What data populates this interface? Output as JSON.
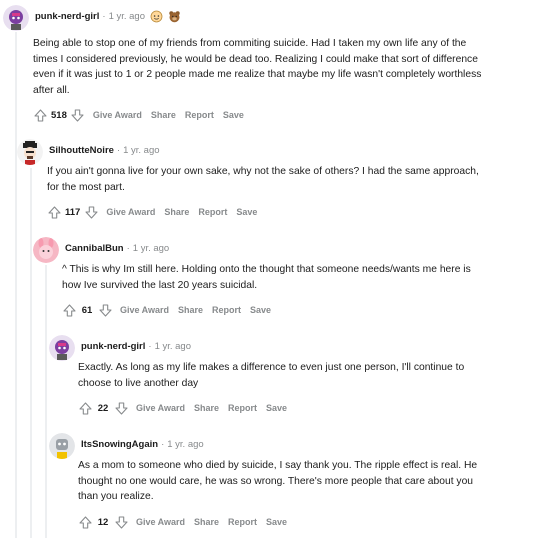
{
  "actions": {
    "give_award": "Give Award",
    "share": "Share",
    "report": "Report",
    "save": "Save"
  },
  "comments": [
    {
      "username": "punk-nerd-girl",
      "age": "1 yr. ago",
      "body": "Being able to stop one of my friends from commiting suicide. Had I taken my own life any of the\ntimes I considered previously, he would be dead too. Realizing I could make that sort of difference\neven if it was just to 1 or 2 people made me realize that maybe my life wasn't completely worthless\nafter all.",
      "score": "518",
      "awards": [
        "wholesome-award-icon",
        "bear-award-icon"
      ]
    },
    {
      "username": "SilhoutteNoire",
      "age": "1 yr. ago",
      "body": "If you ain't gonna live for your own sake, why not the sake of others? I had the same approach,\nfor the most part.",
      "score": "117"
    },
    {
      "username": "CannibalBun",
      "age": "1 yr. ago",
      "body": "^ This is why Im still here. Holding onto the thought that someone needs/wants me here is\nhow Ive survived the last 20 years suicidal.",
      "score": "61"
    },
    {
      "username": "punk-nerd-girl",
      "age": "1 yr. ago",
      "body": "Exactly. As long as my life makes a difference to even just one person, I'll continue to\nchoose to live another day",
      "score": "22"
    },
    {
      "username": "ItsSnowingAgain",
      "age": "1 yr. ago",
      "body": "As a mom to someone who died by suicide, I say thank you. The ripple effect is real. He\nthought no one would care, he was so wrong. There's more people that care about you\nthan you realize.",
      "score": "12"
    }
  ]
}
